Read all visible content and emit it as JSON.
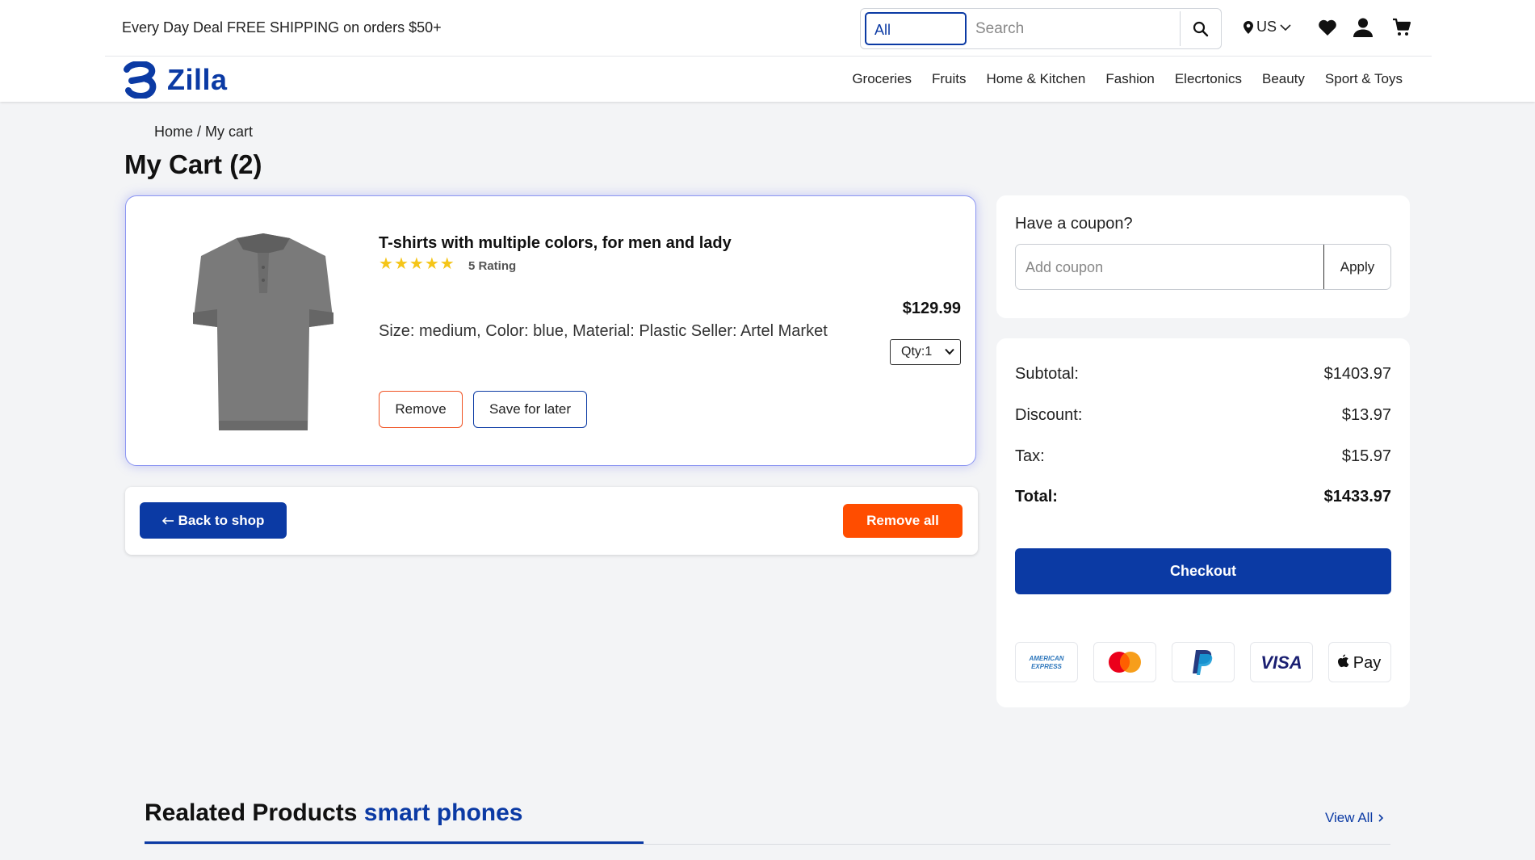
{
  "topbar": {
    "promo": "Every Day Deal FREE SHIPPING on orders $50+",
    "search_category": "All",
    "search_placeholder": "Search",
    "region": "US"
  },
  "brand": {
    "name": "Zilla",
    "color": "#0b3aa4"
  },
  "nav": [
    "Groceries",
    "Fruits",
    "Home & Kitchen",
    "Fashion",
    "Elecrtonics",
    "Beauty",
    "Sport & Toys"
  ],
  "breadcrumb": "Home / My cart",
  "page_title": "My Cart (2)",
  "cart_item": {
    "title": "T-shirts with multiple colors, for men and lady",
    "rating_stars": 5,
    "rating_text": "5 Rating",
    "meta": "Size: medium, Color: blue, Material: Plastic Seller: Artel Market",
    "price": "$129.99",
    "qty": "Qty:1",
    "remove_label": "Remove",
    "save_label": "Save for later"
  },
  "actions": {
    "back_label": "Back to shop",
    "remove_all_label": "Remove all"
  },
  "coupon": {
    "label": "Have a coupon?",
    "placeholder": "Add coupon",
    "apply_label": "Apply"
  },
  "summary": {
    "subtotal_label": "Subtotal:",
    "subtotal": "$1403.97",
    "discount_label": "Discount:",
    "discount": "$13.97",
    "tax_label": "Tax:",
    "tax": "$15.97",
    "total_label": "Total:",
    "total": "$1433.97",
    "checkout_label": "Checkout"
  },
  "payments": [
    "american-express",
    "mastercard",
    "paypal",
    "visa",
    "apple-pay"
  ],
  "related": {
    "title": "Realated Products",
    "accent": "smart phones",
    "view_all": "View All"
  },
  "colors": {
    "primary": "#0b3aa4",
    "danger": "#ff4d00",
    "star": "#f5c518"
  }
}
